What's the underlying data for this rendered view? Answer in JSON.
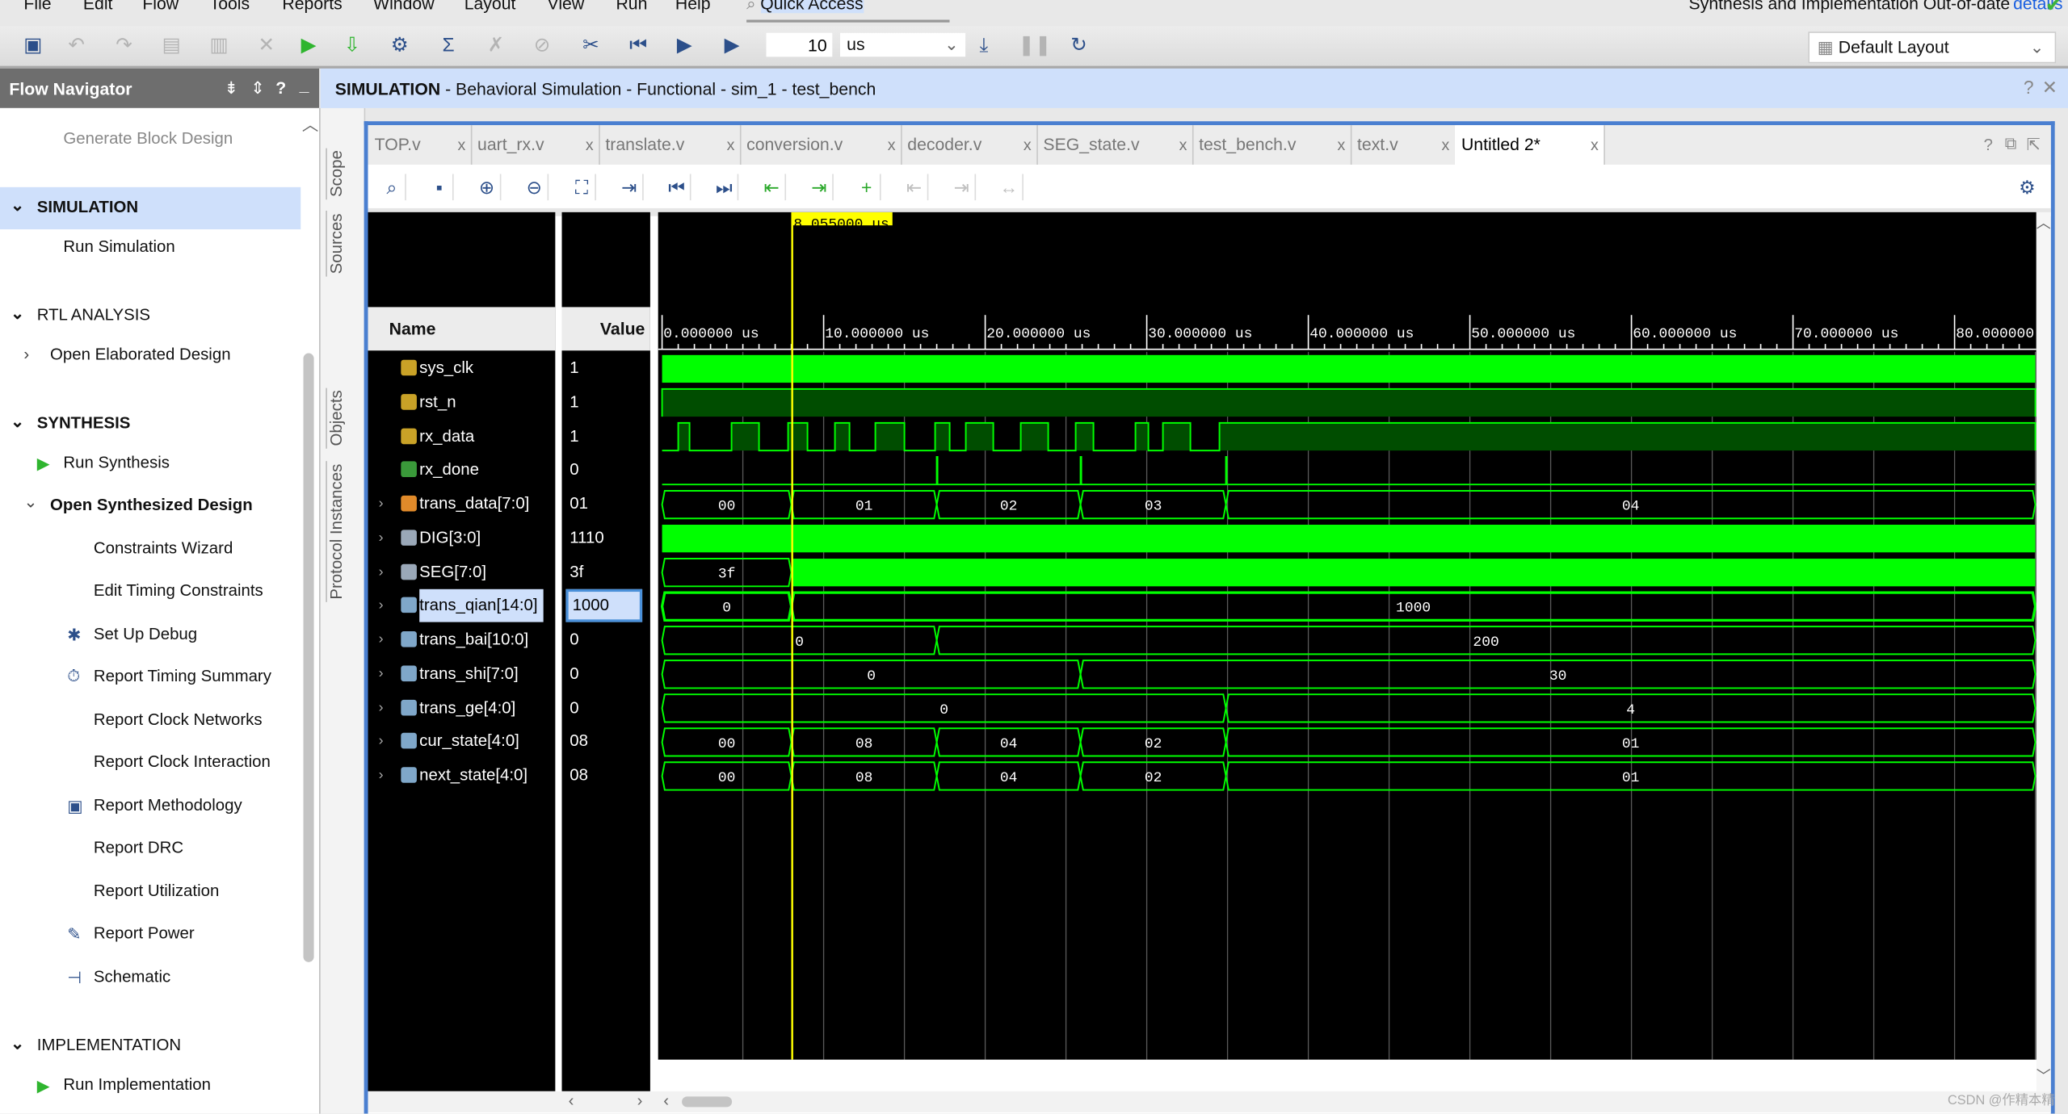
{
  "menu": [
    "File",
    "Edit",
    "Flow",
    "Tools",
    "Reports",
    "Window",
    "Layout",
    "View",
    "Run",
    "Help"
  ],
  "quick_access": "Quick Access",
  "status": {
    "text": "Synthesis and Implementation Out-of-date",
    "link": "details"
  },
  "toolbar": {
    "run_time": "10",
    "run_unit": "us",
    "layout": "Default Layout"
  },
  "flow_navigator": {
    "title": "Flow Navigator",
    "items": [
      {
        "label": "Generate Block Design",
        "level": 2,
        "style": "muted"
      },
      {
        "label": "SIMULATION",
        "level": 0,
        "style": "section-bold",
        "expanded": true,
        "selected": true
      },
      {
        "label": "Run Simulation",
        "level": 2
      },
      {
        "label": "RTL ANALYSIS",
        "level": 0,
        "style": "section",
        "expanded": true
      },
      {
        "label": "Open Elaborated Design",
        "level": 1,
        "collapsed_child": true
      },
      {
        "label": "SYNTHESIS",
        "level": 0,
        "style": "section-bold",
        "expanded": true
      },
      {
        "label": "Run Synthesis",
        "level": 2,
        "icon": "run-icon"
      },
      {
        "label": "Open Synthesized Design",
        "level": 1,
        "style": "bold",
        "expanded": true
      },
      {
        "label": "Constraints Wizard",
        "level": 3
      },
      {
        "label": "Edit Timing Constraints",
        "level": 3
      },
      {
        "label": "Set Up Debug",
        "level": 3,
        "icon": "bug-icon"
      },
      {
        "label": "Report Timing Summary",
        "level": 3,
        "icon": "timer-icon"
      },
      {
        "label": "Report Clock Networks",
        "level": 3
      },
      {
        "label": "Report Clock Interaction",
        "level": 3
      },
      {
        "label": "Report Methodology",
        "level": 3,
        "icon": "clipboard-icon"
      },
      {
        "label": "Report DRC",
        "level": 3
      },
      {
        "label": "Report Utilization",
        "level": 3
      },
      {
        "label": "Report Power",
        "level": 3,
        "icon": "power-icon"
      },
      {
        "label": "Schematic",
        "level": 3,
        "icon": "schematic-icon"
      },
      {
        "label": "IMPLEMENTATION",
        "level": 0,
        "style": "section",
        "expanded": true
      },
      {
        "label": "Run Implementation",
        "level": 2,
        "icon": "run-icon"
      }
    ]
  },
  "side_tabs": [
    "Scope",
    "Sources",
    "Objects",
    "Protocol Instances"
  ],
  "sim_title": {
    "bold": "SIMULATION",
    "rest": " - Behavioral Simulation - Functional - sim_1 - test_bench"
  },
  "tabs": [
    {
      "label": "TOP.v"
    },
    {
      "label": "uart_rx.v"
    },
    {
      "label": "translate.v"
    },
    {
      "label": "conversion.v"
    },
    {
      "label": "decoder.v"
    },
    {
      "label": "SEG_state.v"
    },
    {
      "label": "test_bench.v"
    },
    {
      "label": "text.v"
    },
    {
      "label": "Untitled 2*",
      "active": true
    }
  ],
  "wave": {
    "name_header": "Name",
    "value_header": "Value",
    "cursor": {
      "time_us": 8.055,
      "label": "8.055000 us"
    },
    "time_axis": {
      "unit": "us",
      "ticks": [
        0,
        10,
        20,
        30,
        40,
        50,
        60,
        70,
        80
      ],
      "tick_labels": [
        "0.000000 us",
        "10.000000 us",
        "20.000000 us",
        "30.000000 us",
        "40.000000 us",
        "50.000000 us",
        "60.000000 us",
        "70.000000 us",
        "80.000000"
      ],
      "range_us": [
        0,
        85
      ]
    },
    "colors": {
      "signal": "#00ff00",
      "high_fill": "#004d00",
      "cursor": "#ffff00",
      "grid": "#5a5a5a",
      "background": "#000000"
    },
    "signals": [
      {
        "name": "sys_clk",
        "value": "1",
        "icon": "bit-signal-icon",
        "kind": "dense"
      },
      {
        "name": "rst_n",
        "value": "1",
        "icon": "bit-signal-icon",
        "kind": "bit",
        "high": [
          [
            0,
            85
          ]
        ]
      },
      {
        "name": "rx_data",
        "value": "1",
        "icon": "bit-signal-icon",
        "kind": "bit",
        "high": [
          [
            1.0,
            1.7
          ],
          [
            4.3,
            6.0
          ],
          [
            7.8,
            9.0
          ],
          [
            10.7,
            11.6
          ],
          [
            13.2,
            15.0
          ],
          [
            16.9,
            17.8
          ],
          [
            18.8,
            20.5
          ],
          [
            22.2,
            23.9
          ],
          [
            25.6,
            26.7
          ],
          [
            29.3,
            30.1
          ],
          [
            31.0,
            32.7
          ],
          [
            34.5,
            85
          ]
        ]
      },
      {
        "name": "rx_done",
        "value": "0",
        "icon": "output-bit-icon",
        "kind": "pulse",
        "pulses": [
          17.0,
          25.9,
          34.9
        ]
      },
      {
        "name": "trans_data[7:0]",
        "value": "01",
        "icon": "bus-internal-icon",
        "kind": "bus",
        "expandable": true,
        "segments": [
          [
            0,
            8.0,
            "00"
          ],
          [
            8.0,
            17.0,
            "01"
          ],
          [
            17.0,
            25.9,
            "02"
          ],
          [
            25.9,
            34.9,
            "03"
          ],
          [
            34.9,
            85,
            "04"
          ]
        ]
      },
      {
        "name": "DIG[3:0]",
        "value": "1110",
        "icon": "bus-output-icon",
        "kind": "dense",
        "expandable": true
      },
      {
        "name": "SEG[7:0]",
        "value": "3f",
        "icon": "bus-output-icon",
        "kind": "bus",
        "expandable": true,
        "segments": [
          [
            0,
            8.0,
            "3f"
          ],
          [
            8.0,
            85,
            "",
            "dense"
          ]
        ]
      },
      {
        "name": "trans_qian[14:0]",
        "value": "1000",
        "icon": "bus-signal-icon",
        "kind": "bus",
        "expandable": true,
        "selected": true,
        "segments": [
          [
            0,
            8.0,
            "0"
          ],
          [
            8.0,
            85,
            "1000"
          ]
        ]
      },
      {
        "name": "trans_bai[10:0]",
        "value": "0",
        "icon": "bus-signal-icon",
        "kind": "bus",
        "expandable": true,
        "segments": [
          [
            0,
            17.0,
            "0"
          ],
          [
            17.0,
            85,
            "200"
          ]
        ]
      },
      {
        "name": "trans_shi[7:0]",
        "value": "0",
        "icon": "bus-signal-icon",
        "kind": "bus",
        "expandable": true,
        "segments": [
          [
            0,
            25.9,
            "0"
          ],
          [
            25.9,
            85,
            "30"
          ]
        ]
      },
      {
        "name": "trans_ge[4:0]",
        "value": "0",
        "icon": "bus-signal-icon",
        "kind": "bus",
        "expandable": true,
        "segments": [
          [
            0,
            34.9,
            "0"
          ],
          [
            34.9,
            85,
            "4"
          ]
        ]
      },
      {
        "name": "cur_state[4:0]",
        "value": "08",
        "icon": "bus-signal-icon",
        "kind": "bus",
        "expandable": true,
        "segments": [
          [
            0,
            8.0,
            "00"
          ],
          [
            8.0,
            17.0,
            "08"
          ],
          [
            17.0,
            25.9,
            "04"
          ],
          [
            25.9,
            34.9,
            "02"
          ],
          [
            34.9,
            85,
            "01"
          ]
        ]
      },
      {
        "name": "next_state[4:0]",
        "value": "08",
        "icon": "bus-signal-icon",
        "kind": "bus",
        "expandable": true,
        "segments": [
          [
            0,
            8.0,
            "00"
          ],
          [
            8.0,
            17.0,
            "08"
          ],
          [
            17.0,
            25.9,
            "04"
          ],
          [
            25.9,
            34.9,
            "02"
          ],
          [
            34.9,
            85,
            "01"
          ]
        ]
      }
    ]
  },
  "watermark": "CSDN @作精本精"
}
